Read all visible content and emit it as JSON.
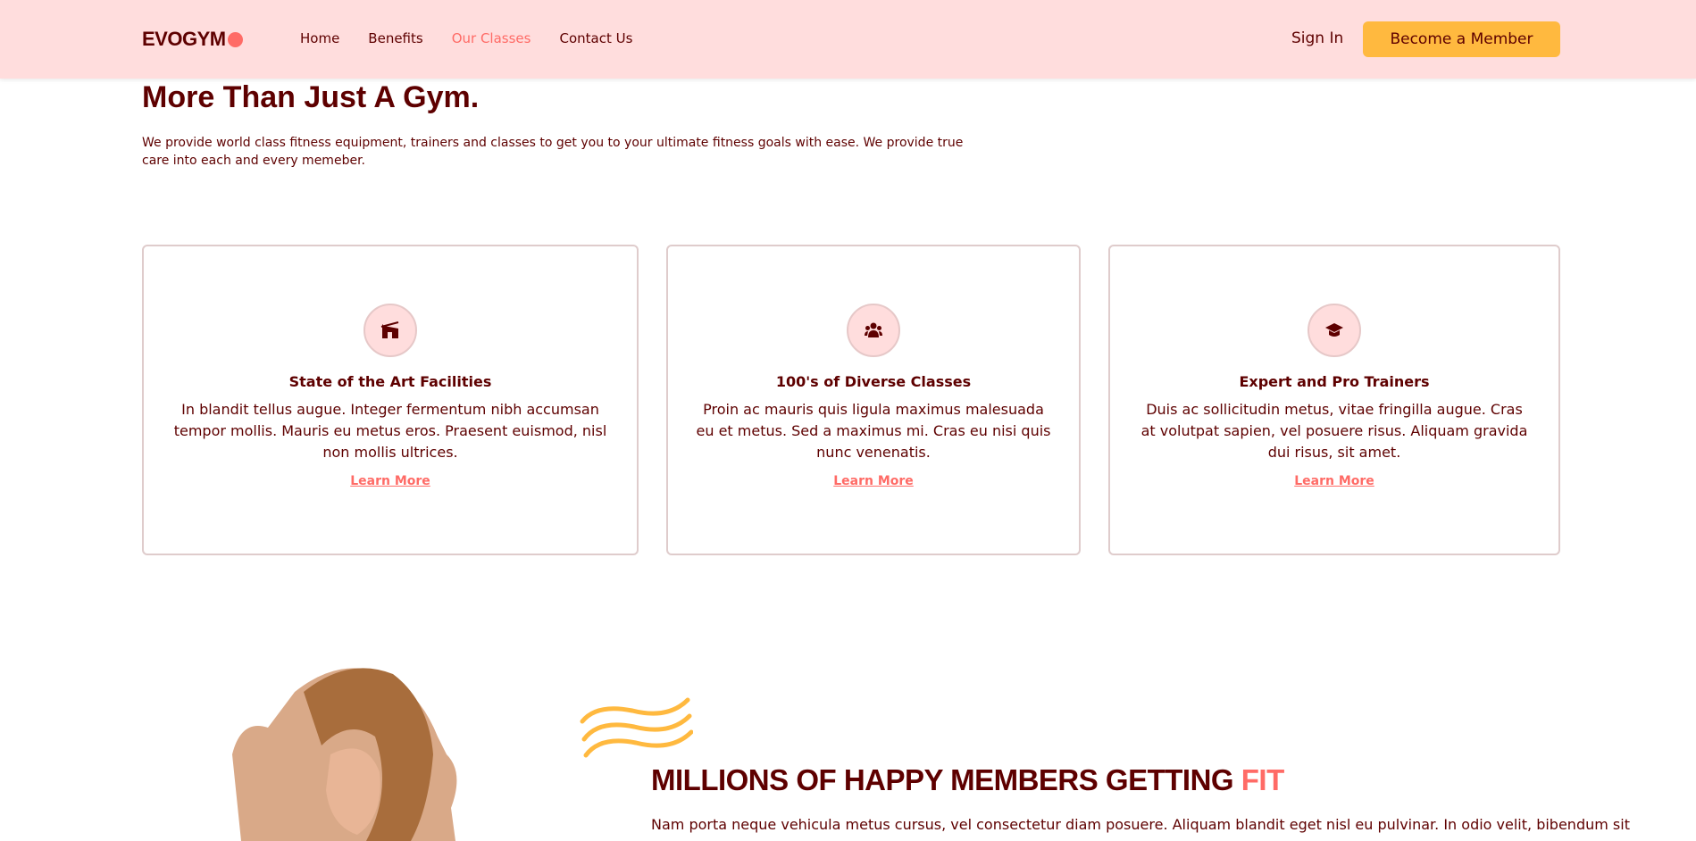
{
  "nav": {
    "logo": "EVOGYM",
    "links": [
      "Home",
      "Benefits",
      "Our Classes",
      "Contact Us"
    ],
    "active_link": "Our Classes",
    "sign_in": "Sign In",
    "cta": "Become a Member"
  },
  "colors": {
    "primary": "#5e0000",
    "accent": "#ff6b66",
    "nav_bg": "#ffdddd",
    "cta_bg": "#ffb93f"
  },
  "hero": {
    "title": "More Than Just A Gym.",
    "description": "We provide world class fitness equipment, trainers and classes to get you to your ultimate fitness goals with ease. We provide true care into each and every memeber."
  },
  "benefits": [
    {
      "icon": "building-icon",
      "title": "State of the Art Facilities",
      "text": "In blandit tellus augue. Integer fermentum nibh accumsan tempor mollis. Mauris eu metus eros. Praesent euismod, nisl non mollis ultrices.",
      "link": "Learn More"
    },
    {
      "icon": "users-icon",
      "title": "100's of Diverse Classes",
      "text": "Proin ac mauris quis ligula maximus malesuada eu et metus. Sed a maximus mi. Cras eu nisi quis nunc venenatis.",
      "link": "Learn More"
    },
    {
      "icon": "graduation-cap-icon",
      "title": "Expert and Pro Trainers",
      "text": "Duis ac sollicitudin metus, vitae fringilla augue. Cras at volutpat sapien, vel posuere risus. Aliquam gravida dui risus, sit amet.",
      "link": "Learn More"
    }
  ],
  "members": {
    "title_main": "MILLIONS OF HAPPY MEMBERS GETTING ",
    "title_accent": "FIT",
    "text": "Nam porta neque vehicula metus cursus, vel consectetur diam posuere. Aliquam blandit eget nisl eu pulvinar. In odio velit, bibendum sit"
  }
}
